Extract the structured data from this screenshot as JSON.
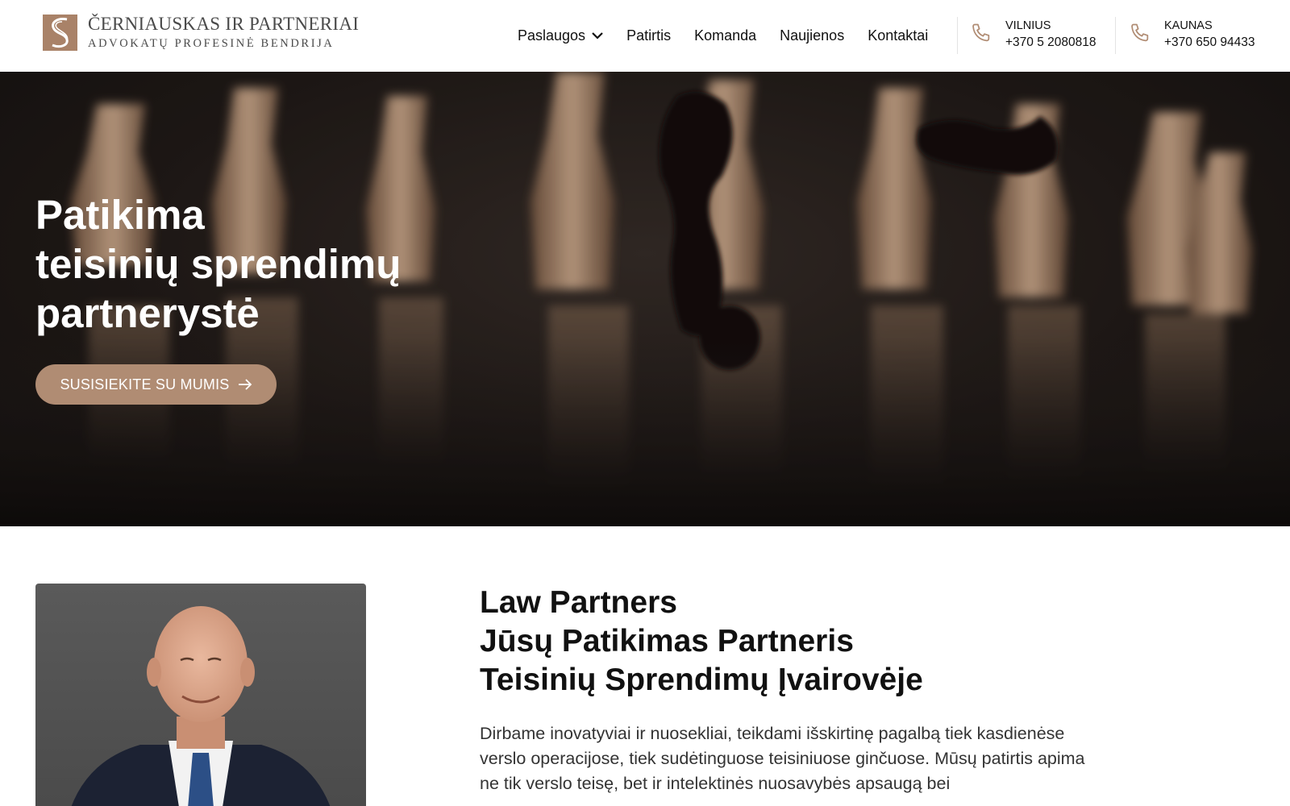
{
  "brand": {
    "name": "ČERNIAUSKAS IR PARTNERIAI",
    "subtitle": "ADVOKATŲ PROFESINĖ BENDRIJA",
    "accent_color": "#b08c73"
  },
  "nav": {
    "items": [
      {
        "label": "Paslaugos",
        "has_dropdown": true
      },
      {
        "label": "Patirtis"
      },
      {
        "label": "Komanda"
      },
      {
        "label": "Naujienos"
      },
      {
        "label": "Kontaktai"
      }
    ]
  },
  "contacts": [
    {
      "city": "VILNIUS",
      "phone": "+370 5 2080818",
      "icon": "phone-icon"
    },
    {
      "city": "KAUNAS",
      "phone": "+370 650 94433",
      "icon": "phone-icon"
    }
  ],
  "hero": {
    "title_lines": [
      "Patikima",
      "teisinių sprendimų",
      "partnerystė"
    ],
    "cta_label": "SUSISIEKITE SU MUMIS",
    "cta_icon": "arrow-right-icon"
  },
  "about": {
    "title_lines": [
      "Law Partners",
      "Jūsų Patikimas Partneris",
      "Teisinių Sprendimų Įvairovėje"
    ],
    "text": "Dirbame inovatyviai ir nuosekliai, teikdami išskirtinę pagalbą tiek kasdienėse verslo operacijose, tiek sudėtinguose teisiniuose ginčuose. Mūsų patirtis apima ne tik verslo teisę, bet ir intelektinės nuosavybės apsaugą bei"
  }
}
